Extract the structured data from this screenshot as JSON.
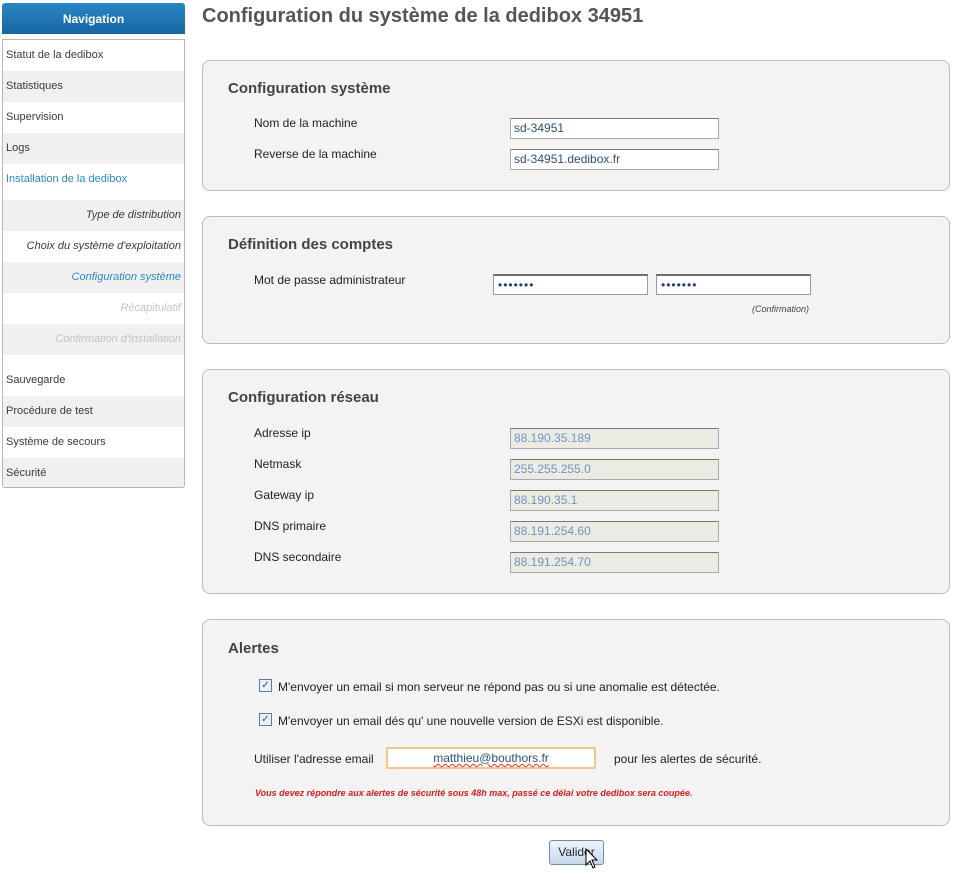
{
  "sidebar": {
    "header": "Navigation",
    "items": [
      {
        "label": "Statut de la dedibox"
      },
      {
        "label": "Statistiques"
      },
      {
        "label": "Supervision"
      },
      {
        "label": "Logs"
      },
      {
        "label": "Installation de la dedibox"
      },
      {
        "label": "Type de distribution"
      },
      {
        "label": "Choix du système d'exploitation"
      },
      {
        "label": "Configuration système"
      },
      {
        "label": "Récapitulatif"
      },
      {
        "label": "Confirmation d'installation"
      },
      {
        "label": "Sauvegarde"
      },
      {
        "label": "Procédure de test"
      },
      {
        "label": "Système de secours"
      },
      {
        "label": "Sécurité"
      }
    ]
  },
  "page": {
    "title": "Configuration du système de la dedibox 34951"
  },
  "system": {
    "title": "Configuration système",
    "hostname_label": "Nom de la machine",
    "hostname_value": "sd-34951",
    "reverse_label": "Reverse de la machine",
    "reverse_value": "sd-34951.dedibox.fr"
  },
  "accounts": {
    "title": "Définition des comptes",
    "password_label": "Mot de passe administrateur",
    "password_mask": "•••••••",
    "confirm_mask": "•••••••",
    "confirm_note": "(Confirmation)"
  },
  "network": {
    "title": "Configuration réseau",
    "fields": [
      {
        "label": "Adresse ip",
        "value": "88.190.35.189"
      },
      {
        "label": "Netmask",
        "value": "255.255.255.0"
      },
      {
        "label": "Gateway ip",
        "value": "88.190.35.1"
      },
      {
        "label": "DNS primaire",
        "value": "88.191.254.60"
      },
      {
        "label": "DNS secondaire",
        "value": "88.191.254.70"
      }
    ]
  },
  "alerts": {
    "title": "Alertes",
    "option1": "M'envoyer un email si mon serveur ne répond pas ou si une anomalie est détectée.",
    "option2": "M'envoyer un email dés qu' une nouvelle version de ESXi est disponible.",
    "email_prefix": "Utiliser l'adresse email",
    "email_value": "matthieu@bouthors.fr",
    "email_suffix": "pour les alertes de sécurité.",
    "warning": "Vous devez répondre aux alertes de sécurité sous 48h max, passé ce délai votre dedibox sera coupée."
  },
  "actions": {
    "submit_label": "Valider"
  }
}
